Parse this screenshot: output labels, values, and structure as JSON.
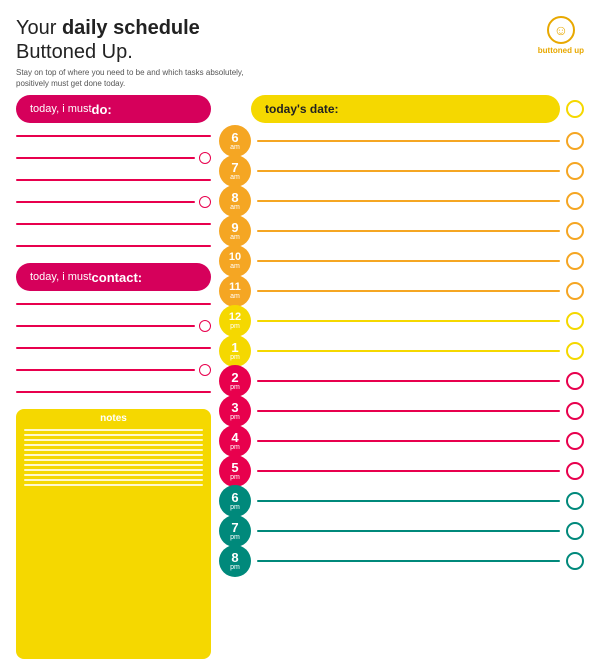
{
  "header": {
    "title_prefix": "Your ",
    "title_bold": "daily schedule",
    "title_line2": "Buttoned Up.",
    "subtitle": "Stay on top of where you need to be and which tasks absolutely, positively must get done today.",
    "brand": "buttoned up",
    "logo_icon": "☺"
  },
  "today_date_label": "today's date:",
  "sections": {
    "do_label": "today, i must ",
    "do_bold": "do:",
    "contact_label": "today, i must ",
    "contact_bold": "contact:",
    "notes_label": "notes"
  },
  "times": [
    {
      "hour": "6",
      "period": "am",
      "color": "orange"
    },
    {
      "hour": "7",
      "period": "am",
      "color": "orange"
    },
    {
      "hour": "8",
      "period": "am",
      "color": "orange"
    },
    {
      "hour": "9",
      "period": "am",
      "color": "orange"
    },
    {
      "hour": "10",
      "period": "am",
      "color": "orange"
    },
    {
      "hour": "11",
      "period": "am",
      "color": "orange"
    },
    {
      "hour": "12",
      "period": "pm",
      "color": "yellow"
    },
    {
      "hour": "1",
      "period": "pm",
      "color": "yellow"
    },
    {
      "hour": "2",
      "period": "pm",
      "color": "red"
    },
    {
      "hour": "3",
      "period": "pm",
      "color": "red"
    },
    {
      "hour": "4",
      "period": "pm",
      "color": "red"
    },
    {
      "hour": "5",
      "period": "pm",
      "color": "red"
    },
    {
      "hour": "6",
      "period": "pm",
      "color": "teal"
    },
    {
      "hour": "7",
      "period": "pm",
      "color": "teal"
    },
    {
      "hour": "8",
      "period": "pm",
      "color": "teal"
    }
  ],
  "do_lines": 4,
  "contact_lines": 4,
  "notes_lines": 14
}
